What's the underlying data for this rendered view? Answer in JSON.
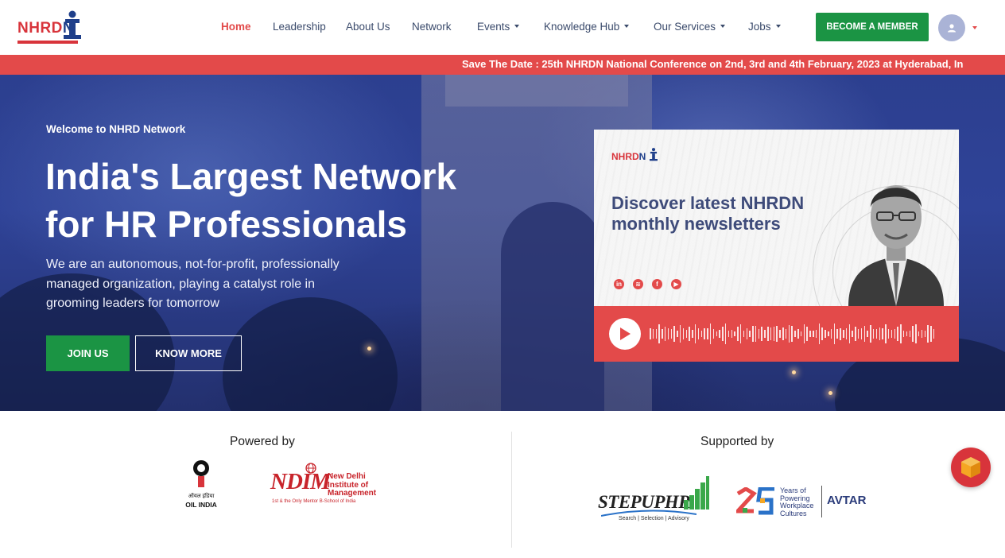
{
  "brand": {
    "logo_text": "NHRD",
    "logo_suffix": "N"
  },
  "nav": {
    "items": [
      {
        "label": "Home",
        "active": true
      },
      {
        "label": "Leadership"
      },
      {
        "label": "About Us"
      },
      {
        "label": "Network"
      },
      {
        "label": "Events",
        "dropdown": true
      },
      {
        "label": "Knowledge Hub",
        "dropdown": true
      },
      {
        "label": "Our Services",
        "dropdown": true
      },
      {
        "label": "Jobs",
        "dropdown": true
      }
    ],
    "cta_label": "BECOME A MEMBER"
  },
  "ticker": {
    "text": "Save The Date : 25th NHRDN National Conference on 2nd, 3rd and 4th February, 2023 at Hyderabad, In"
  },
  "hero": {
    "welcome": "Welcome to NHRD Network",
    "title_line1": "India's Largest Network",
    "title_line2": "for HR Professionals",
    "description": "We are an autonomous, not-for-profit, professionally managed organization, playing a catalyst role in grooming leaders for tomorrow",
    "join_label": "JOIN US",
    "know_label": "KNOW MORE"
  },
  "newsletter_card": {
    "logo_text": "NHRD",
    "logo_suffix": "N",
    "title": "Discover latest NHRDN monthly newsletters",
    "socials": [
      "linkedin-icon",
      "spotify-icon",
      "facebook-icon",
      "youtube-icon"
    ]
  },
  "partners": {
    "powered_title": "Powered by",
    "supported_title": "Supported by",
    "oil_hindi": "ऑयल इंडिया",
    "oil_name": "OIL INDIA",
    "ndim_mark": "NDIM",
    "ndim_name": "New Delhi Institute of Management",
    "ndim_tag": "1st & the Only Mentor B-School of India",
    "stepup_name": "STEPUPHR",
    "stepup_tag": "Search | Selection | Advisory",
    "avtar_years": "25",
    "avtar_tagline": "Years of Powering Workplace Cultures",
    "avtar_name": "AVTAR"
  },
  "colors": {
    "accent_red": "#e34a4a",
    "green": "#1b9444",
    "navy": "#2c3f8f"
  }
}
